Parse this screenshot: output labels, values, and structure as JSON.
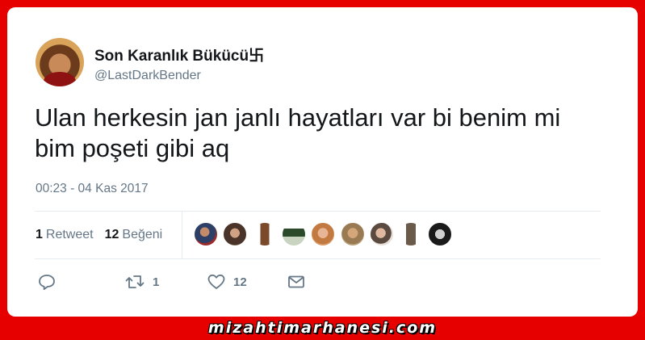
{
  "tweet": {
    "display_name": "Son Karanlık Bükücü卐",
    "handle": "@LastDarkBender",
    "text": "Ulan herkesin jan janlı hayatları var bi benim mi bim poşeti gibi aq",
    "timestamp": "00:23 - 04 Kas 2017",
    "stats": {
      "retweet_count": "1",
      "retweet_label": "Retweet",
      "like_count": "12",
      "like_label": "Beğeni"
    },
    "actions": {
      "reply_icon": "reply-icon",
      "retweet_icon": "retweet-icon",
      "retweet_count": "1",
      "like_icon": "heart-icon",
      "like_count": "12",
      "dm_icon": "envelope-icon"
    }
  },
  "watermark": "mizahtimarhanesi.com",
  "colors": {
    "background": "#e60000",
    "card": "#ffffff",
    "text": "#14171a",
    "muted": "#657786"
  }
}
